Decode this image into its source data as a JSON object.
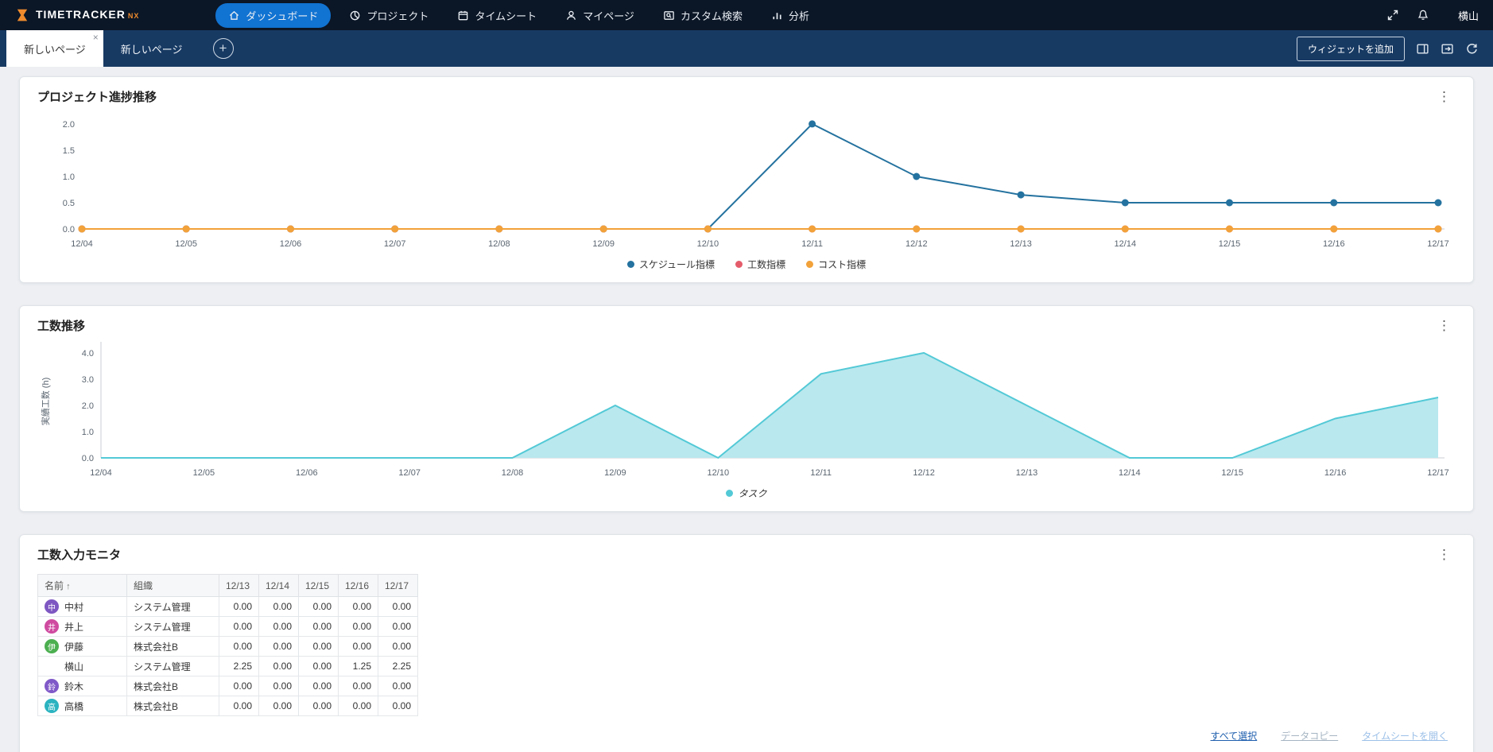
{
  "header": {
    "brand": "TIMETRACKER",
    "brand_suffix": "NX",
    "user_name": "横山",
    "nav": [
      {
        "label": "ダッシュボード",
        "active": true
      },
      {
        "label": "プロジェクト",
        "active": false
      },
      {
        "label": "タイムシート",
        "active": false
      },
      {
        "label": "マイページ",
        "active": false
      },
      {
        "label": "カスタム検索",
        "active": false
      },
      {
        "label": "分析",
        "active": false
      }
    ]
  },
  "tabbar": {
    "tabs": [
      {
        "label": "新しいページ",
        "active": true,
        "closable": true
      },
      {
        "label": "新しいページ",
        "active": false
      }
    ],
    "add_widget_label": "ウィジェットを追加"
  },
  "progress_card": {
    "title": "プロジェクト進捗推移"
  },
  "effort_card": {
    "title": "工数推移"
  },
  "monitor_card": {
    "title": "工数入力モニタ",
    "table": {
      "headers": [
        "名前",
        "組織",
        "12/13",
        "12/14",
        "12/15",
        "12/16",
        "12/17"
      ],
      "sort_column": "名前",
      "sort_direction": "asc",
      "rows": [
        {
          "name": "中村",
          "avatar": "中",
          "avatar_color": "#7e57c2",
          "org": "システム管理",
          "values": [
            "0.00",
            "0.00",
            "0.00",
            "0.00",
            "0.00"
          ]
        },
        {
          "name": "井上",
          "avatar": "井",
          "avatar_color": "#cf4ba0",
          "org": "システム管理",
          "values": [
            "0.00",
            "0.00",
            "0.00",
            "0.00",
            "0.00"
          ]
        },
        {
          "name": "伊藤",
          "avatar": "伊",
          "avatar_color": "#4caf50",
          "org": "株式会社B",
          "values": [
            "0.00",
            "0.00",
            "0.00",
            "0.00",
            "0.00"
          ]
        },
        {
          "name": "横山",
          "avatar": null,
          "avatar_color": null,
          "org": "システム管理",
          "values": [
            "2.25",
            "0.00",
            "0.00",
            "1.25",
            "2.25"
          ]
        },
        {
          "name": "鈴木",
          "avatar": "鈴",
          "avatar_color": "#8059c8",
          "org": "株式会社B",
          "values": [
            "0.00",
            "0.00",
            "0.00",
            "0.00",
            "0.00"
          ]
        },
        {
          "name": "高橋",
          "avatar": "高",
          "avatar_color": "#2bb3c0",
          "org": "株式会社B",
          "values": [
            "0.00",
            "0.00",
            "0.00",
            "0.00",
            "0.00"
          ]
        }
      ]
    },
    "links": [
      {
        "label": "すべて選択",
        "color": "#1f5fae",
        "name": "select-all-link",
        "enabled": true
      },
      {
        "label": "データコピー",
        "color": "#a5b4c2",
        "name": "data-copy-link",
        "enabled": false
      },
      {
        "label": "タイムシートを開く",
        "color": "#9cc0e8",
        "name": "open-timesheet-link",
        "enabled": false
      }
    ]
  },
  "chart_data": [
    {
      "type": "line",
      "title": "プロジェクト進捗推移",
      "categories": [
        "12/04",
        "12/05",
        "12/06",
        "12/07",
        "12/08",
        "12/09",
        "12/10",
        "12/11",
        "12/12",
        "12/13",
        "12/14",
        "12/15",
        "12/16",
        "12/17"
      ],
      "series": [
        {
          "name": "スケジュール指標",
          "color": "#24729f",
          "values": [
            0,
            0,
            0,
            0,
            0,
            0,
            0,
            2,
            1,
            0.65,
            0.5,
            0.5,
            0.5,
            0.5
          ]
        },
        {
          "name": "工数指標",
          "color": "#e45c6b",
          "values": [
            0,
            0,
            0,
            0,
            0,
            0,
            0,
            0,
            0,
            0,
            0,
            0,
            0,
            0
          ]
        },
        {
          "name": "コスト指標",
          "color": "#f2a23a",
          "values": [
            0,
            0,
            0,
            0,
            0,
            0,
            0,
            0,
            0,
            0,
            0,
            0,
            0,
            0
          ]
        }
      ],
      "ylim": [
        0,
        2.15
      ],
      "yticks": [
        0,
        0.5,
        1,
        1.5,
        2
      ],
      "xlabel": "",
      "ylabel": "",
      "legend_position": "bottom",
      "grid": false
    },
    {
      "type": "area",
      "title": "工数推移",
      "categories": [
        "12/04",
        "12/05",
        "12/06",
        "12/07",
        "12/08",
        "12/09",
        "12/10",
        "12/11",
        "12/12",
        "12/13",
        "12/14",
        "12/15",
        "12/16",
        "12/17"
      ],
      "series": [
        {
          "name": "タスク",
          "color": "#53c9d6",
          "fill": "#b9e8ee",
          "values": [
            0,
            0,
            0,
            0,
            0,
            2,
            0,
            3.2,
            4,
            2,
            0,
            0,
            1.5,
            2.3
          ]
        }
      ],
      "ylim": [
        0,
        4.3
      ],
      "yticks": [
        0,
        1,
        2,
        3,
        4
      ],
      "xlabel": "",
      "ylabel": "実績工数 (h)",
      "legend_position": "bottom",
      "grid": false
    }
  ]
}
